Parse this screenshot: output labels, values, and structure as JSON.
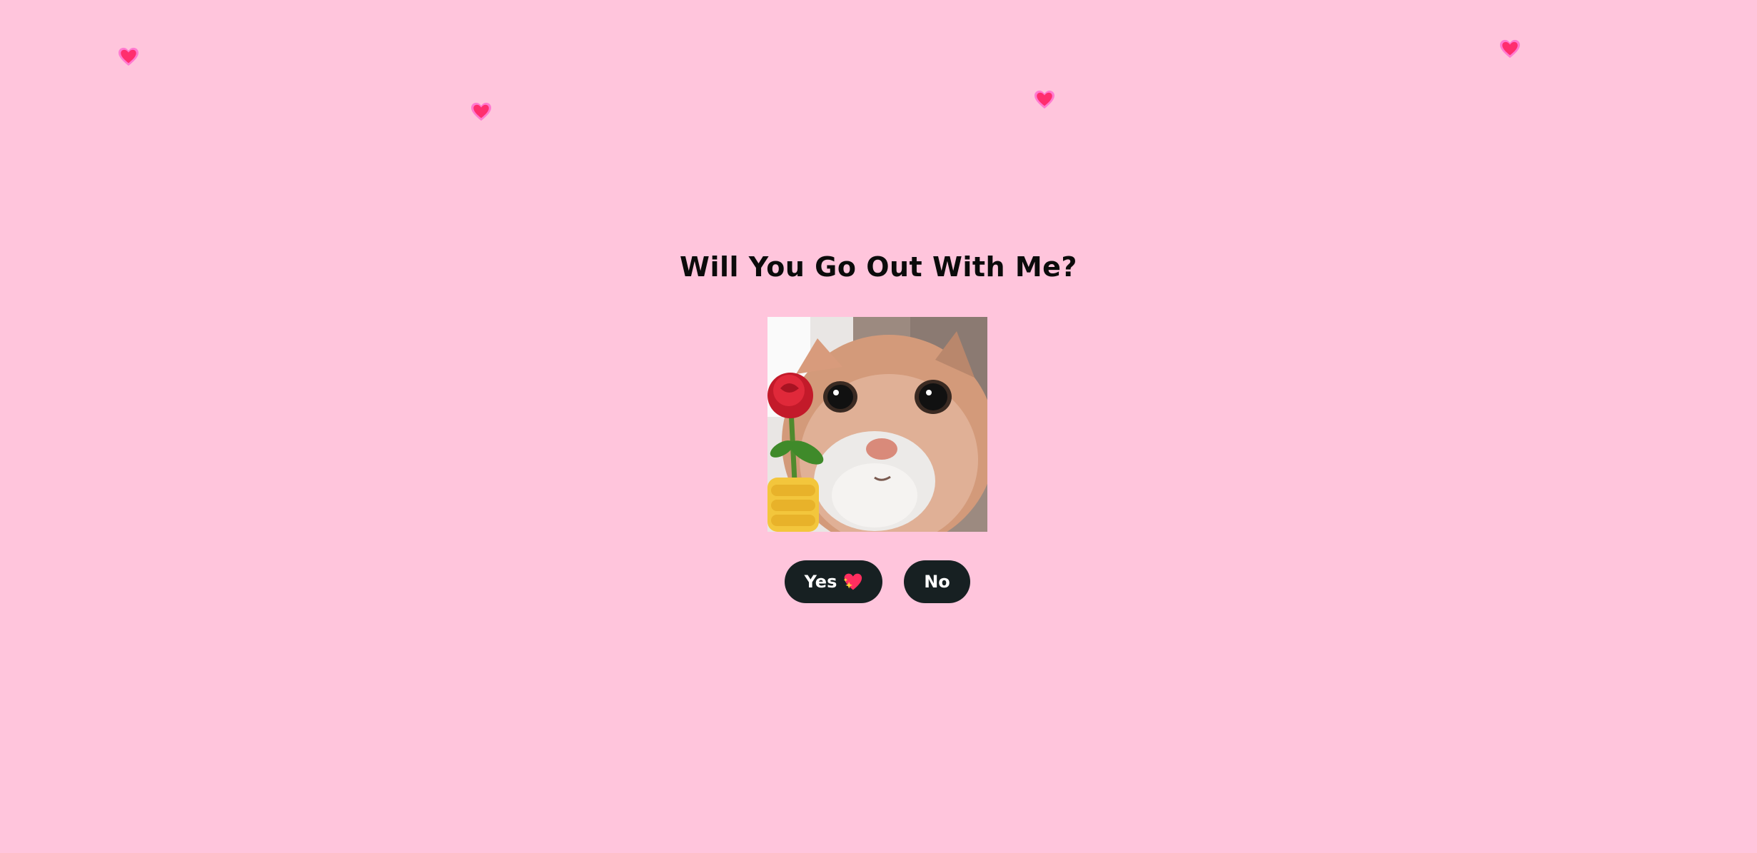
{
  "page": {
    "title": "Will You Go Out With Me?",
    "background_color": "#ffc5dc"
  },
  "image": {
    "description_icon": "cat-with-rose-image"
  },
  "buttons": {
    "yes_label": "Yes",
    "yes_icon": "sparkling-heart-icon",
    "no_label": "No",
    "button_color": "#172022"
  },
  "decorations": {
    "heart_icon": "heart-icon",
    "heart_color": "#ff2e7a",
    "heart_glow": "#ff7ad0"
  }
}
